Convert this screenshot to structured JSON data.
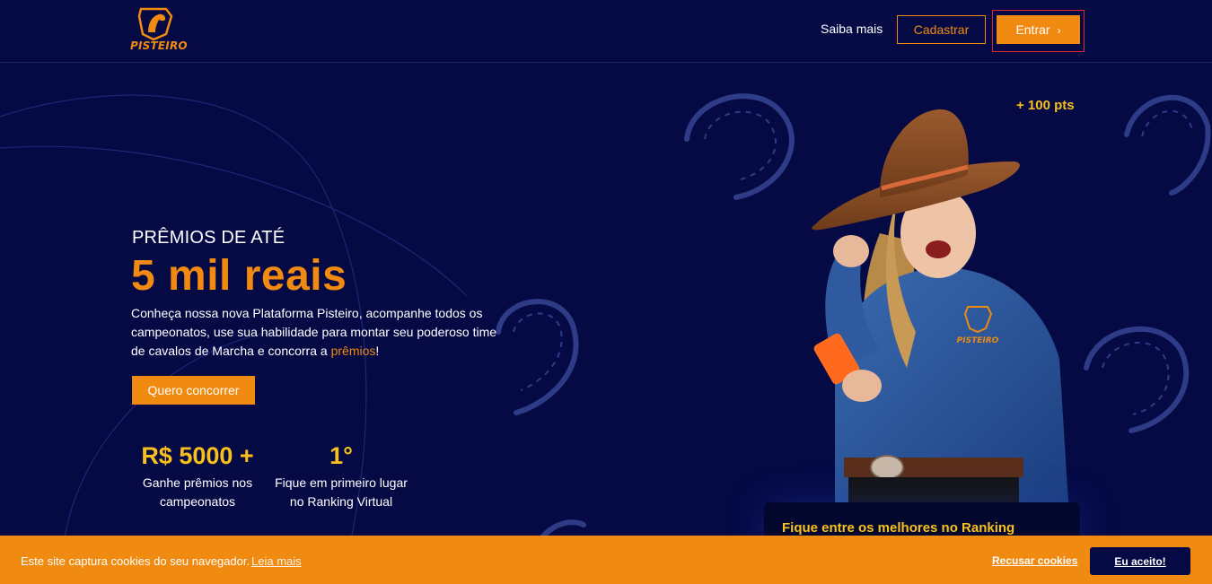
{
  "header": {
    "logo_text": "PISTEIRO",
    "nav_saiba_mais": "Saiba mais",
    "cadastrar_label": "Cadastrar",
    "entrar_label": "Entrar",
    "entrar_chevron": "›"
  },
  "hero": {
    "kicker": "PRÊMIOS DE ATÉ",
    "title": "5 mil reais",
    "description_before": "Conheça nossa nova Plataforma Pisteiro, acompanhe todos os campeonatos, use sua habilidade para montar seu poderoso time de cavalos de Marcha e concorra a ",
    "description_highlight": "prêmios",
    "description_after": "!",
    "cta_label": "Quero concorrer"
  },
  "stats": [
    {
      "value": "R$ 5000 +",
      "label_line1": "Ganhe prêmios nos",
      "label_line2": "campeonatos"
    },
    {
      "value": "1°",
      "label_line1": "Fique em primeiro lugar",
      "label_line2": "no Ranking Virtual"
    }
  ],
  "points_badge": "+ 100 pts",
  "shirt_logo_text": "PISTEIRO",
  "ranking_card": {
    "title": "Fique entre os melhores no Ranking"
  },
  "cookie_bar": {
    "message": "Este site captura cookies do seu navegador.",
    "read_more": "Leia mais",
    "decline": "Recusar cookies",
    "accept": "Eu aceito!"
  },
  "colors": {
    "background": "#050a45",
    "accent_orange": "#f08a10",
    "accent_yellow": "#f8c01c",
    "highlight_border": "#e0262c"
  }
}
